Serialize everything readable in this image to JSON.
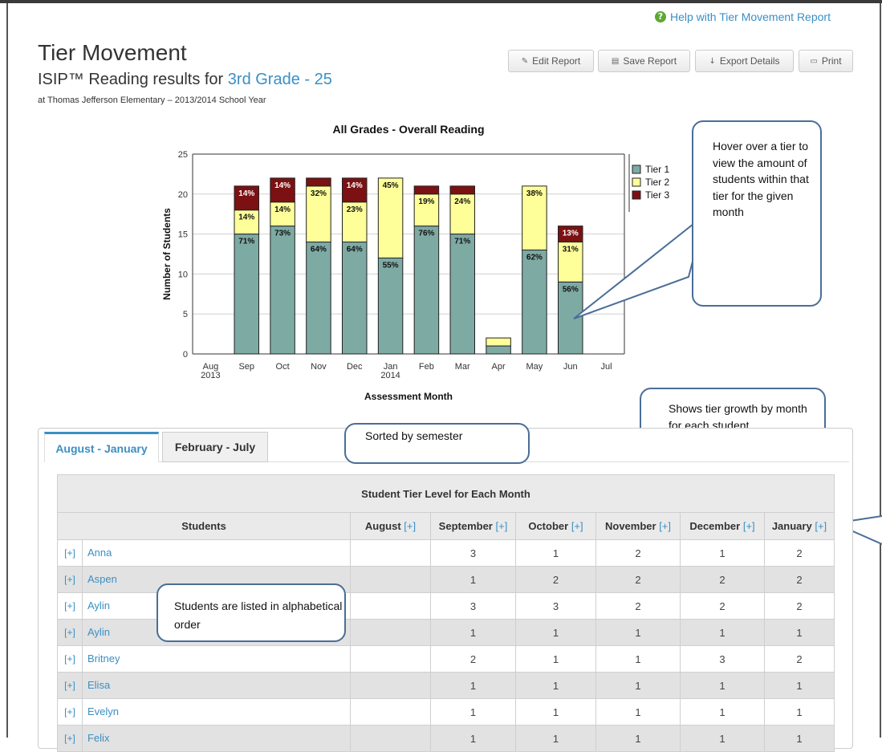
{
  "help": {
    "text": "Help with Tier Movement Report"
  },
  "header": {
    "title": "Tier Movement",
    "subtitle_prefix": "ISIP™ Reading results for ",
    "grade_link": "3rd Grade - 25",
    "school_line": "at Thomas Jefferson Elementary – 2013/2014 School Year"
  },
  "toolbar": {
    "edit": "Edit Report",
    "save": "Save Report",
    "export": "Export Details",
    "print": "Print"
  },
  "chart_data": {
    "type": "bar",
    "title": "All Grades - Overall Reading",
    "xlabel": "Assessment Month",
    "ylabel": "Number of Students",
    "ylim": [
      0,
      25
    ],
    "yticks": [
      0,
      5,
      10,
      15,
      20,
      25
    ],
    "categories": [
      [
        "Aug",
        "2013"
      ],
      [
        "Sep"
      ],
      [
        "Oct"
      ],
      [
        "Nov"
      ],
      [
        "Dec"
      ],
      [
        "Jan",
        "2014"
      ],
      [
        "Feb"
      ],
      [
        "Mar"
      ],
      [
        "Apr"
      ],
      [
        "May"
      ],
      [
        "Jun"
      ],
      [
        "Jul"
      ]
    ],
    "stacked": true,
    "grid": true,
    "legend_position": "right",
    "series": [
      {
        "name": "Tier 1",
        "color": "#7eaaa4",
        "values": [
          0,
          15,
          16,
          14,
          14,
          12,
          16,
          15,
          1,
          13,
          9,
          0
        ],
        "labels": [
          "",
          "71%",
          "73%",
          "64%",
          "64%",
          "55%",
          "76%",
          "71%",
          "",
          "62%",
          "56%",
          ""
        ]
      },
      {
        "name": "Tier 2",
        "color": "#ffff99",
        "values": [
          0,
          3,
          3,
          7,
          5,
          10,
          4,
          5,
          1,
          8,
          5,
          0
        ],
        "labels": [
          "",
          "14%",
          "14%",
          "32%",
          "23%",
          "45%",
          "19%",
          "24%",
          "",
          "38%",
          "31%",
          ""
        ]
      },
      {
        "name": "Tier 3",
        "color": "#7b1113",
        "values": [
          0,
          3,
          3,
          1,
          3,
          0,
          1,
          1,
          0,
          0,
          2,
          0
        ],
        "labels": [
          "",
          "14%",
          "14%",
          "",
          "14%",
          "",
          "",
          "",
          "",
          "",
          "13%",
          ""
        ]
      }
    ]
  },
  "callouts": {
    "hover": "Hover over a tier to view the amount of students within that tier for the given month",
    "growth": "Shows tier growth by month for each student",
    "semester": "Sorted by semester",
    "alpha": "Students are listed in alphabetical order"
  },
  "tabs": [
    {
      "label": "August - January",
      "active": true
    },
    {
      "label": "February - July",
      "active": false
    }
  ],
  "table": {
    "caption": "Student Tier Level for Each Month",
    "students_header": "Students",
    "expand_label": "[+]",
    "months": [
      "August",
      "September",
      "October",
      "November",
      "December",
      "January"
    ],
    "rows": [
      {
        "name": "Anna",
        "values": [
          "",
          "3",
          "1",
          "2",
          "1",
          "2"
        ]
      },
      {
        "name": "Aspen",
        "values": [
          "",
          "1",
          "2",
          "2",
          "2",
          "2"
        ]
      },
      {
        "name": "Aylin",
        "values": [
          "",
          "3",
          "3",
          "2",
          "2",
          "2"
        ]
      },
      {
        "name": "Aylin",
        "values": [
          "",
          "1",
          "1",
          "1",
          "1",
          "1"
        ]
      },
      {
        "name": "Britney",
        "values": [
          "",
          "2",
          "1",
          "1",
          "3",
          "2"
        ]
      },
      {
        "name": "Elisa",
        "values": [
          "",
          "1",
          "1",
          "1",
          "1",
          "1"
        ]
      },
      {
        "name": "Evelyn",
        "values": [
          "",
          "1",
          "1",
          "1",
          "1",
          "1"
        ]
      },
      {
        "name": "Felix",
        "values": [
          "",
          "1",
          "1",
          "1",
          "1",
          "1"
        ]
      }
    ]
  }
}
